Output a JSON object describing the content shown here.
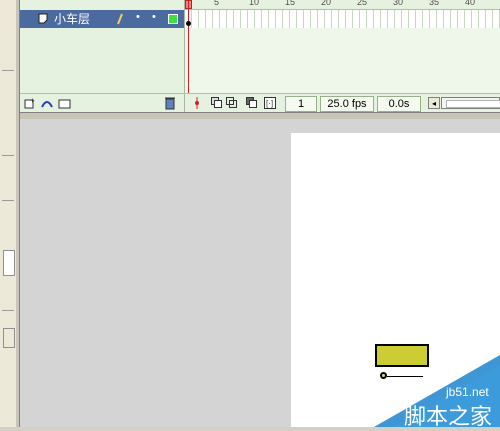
{
  "timeline": {
    "ruler_ticks": [
      "5",
      "10",
      "15",
      "20",
      "25",
      "30",
      "35",
      "40"
    ],
    "layer_name": "小车层",
    "current_frame": "1",
    "frame_rate": "25.0 fps",
    "elapsed_time": "0.0s"
  },
  "watermark": {
    "line1": "jb51.net",
    "line2": "脚本之家"
  },
  "colors": {
    "layer_selected": "#4b6aa0",
    "timeline_bg": "#e6f2e0",
    "car_body": "#cccc33",
    "playhead": "#d0202a"
  },
  "icons": [
    "layer-page-icon",
    "pencil-icon",
    "dot-icon",
    "outline-square-icon",
    "add-layer-icon",
    "add-motion-guide-icon",
    "insert-folder-icon",
    "trash-icon",
    "onion-skin-icon",
    "edit-multiple-frames-icon",
    "scroll-left-icon"
  ]
}
